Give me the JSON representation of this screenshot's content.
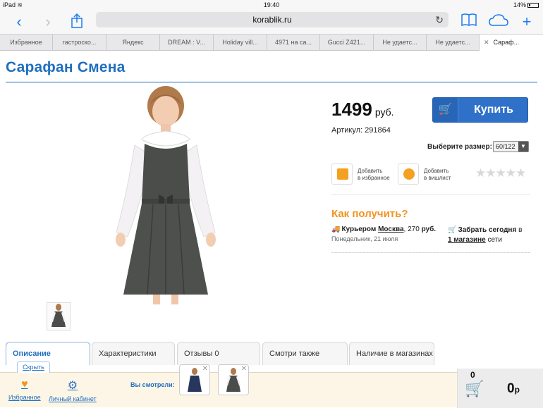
{
  "status_bar": {
    "device": "iPad",
    "wifi_icon": "wifi-icon",
    "time": "19:40",
    "battery": "14%"
  },
  "browser": {
    "url": "korablik.ru",
    "buttons": {
      "back": "back-icon",
      "forward": "forward-icon",
      "share": "share-icon",
      "reload": "reload-icon",
      "bookmarks": "book-icon",
      "icloud": "cloud-icon",
      "new_tab": "plus-icon"
    },
    "tabs": [
      {
        "label": "Избранное"
      },
      {
        "label": "гастроско..."
      },
      {
        "label": "Яндекс"
      },
      {
        "label": "DREAM : V..."
      },
      {
        "label": "Holiday vill..."
      },
      {
        "label": "4971 на са..."
      },
      {
        "label": "Gucci Z421..."
      },
      {
        "label": "Не удаетс..."
      },
      {
        "label": "Не удаетс..."
      },
      {
        "label": "Сараф...",
        "close": "✕",
        "active": true
      }
    ]
  },
  "product": {
    "title": "Сарафан Смена",
    "price": "1499",
    "currency": "руб.",
    "article": "Артикул: 291864",
    "buy_label": "Купить",
    "size_label": "Выберите размер:",
    "size_value": "60/122",
    "favorite_line1": "Добавить",
    "favorite_line2": "в избранное",
    "wishlist_line1": "Добавить",
    "wishlist_line2": "в вишлист",
    "rating": 0,
    "rating_max": 5,
    "how_to_get": "Как получить?",
    "courier_prefix": "Курьером",
    "courier_city": "Москва",
    "courier_price_prefix": ", 270",
    "courier_price": "руб.",
    "courier_date": "Понедельник, 21 июля",
    "pickup_title": "Забрать сегодня",
    "pickup_in": "в",
    "pickup_store": "1 магазине",
    "pickup_suffix": "сети"
  },
  "tabs": [
    {
      "label": "Описание",
      "active": true
    },
    {
      "label": "Характеристики"
    },
    {
      "label": "Отзывы 0"
    },
    {
      "label": "Смотри также"
    },
    {
      "label": "Наличие в магазинах"
    }
  ],
  "bottom_bar": {
    "hide_label": "Скрыть",
    "favorites_label": "Избранное",
    "cabinet_label": "Личный кабинет",
    "seen_label": "Вы смотрели:",
    "cart_count": "0",
    "cart_total": "0",
    "cart_currency": "р"
  },
  "colors": {
    "accent": "#1f6fbf",
    "buy_button": "#2f71c9",
    "orange": "#f39321",
    "dress": "#4a4d4a"
  }
}
